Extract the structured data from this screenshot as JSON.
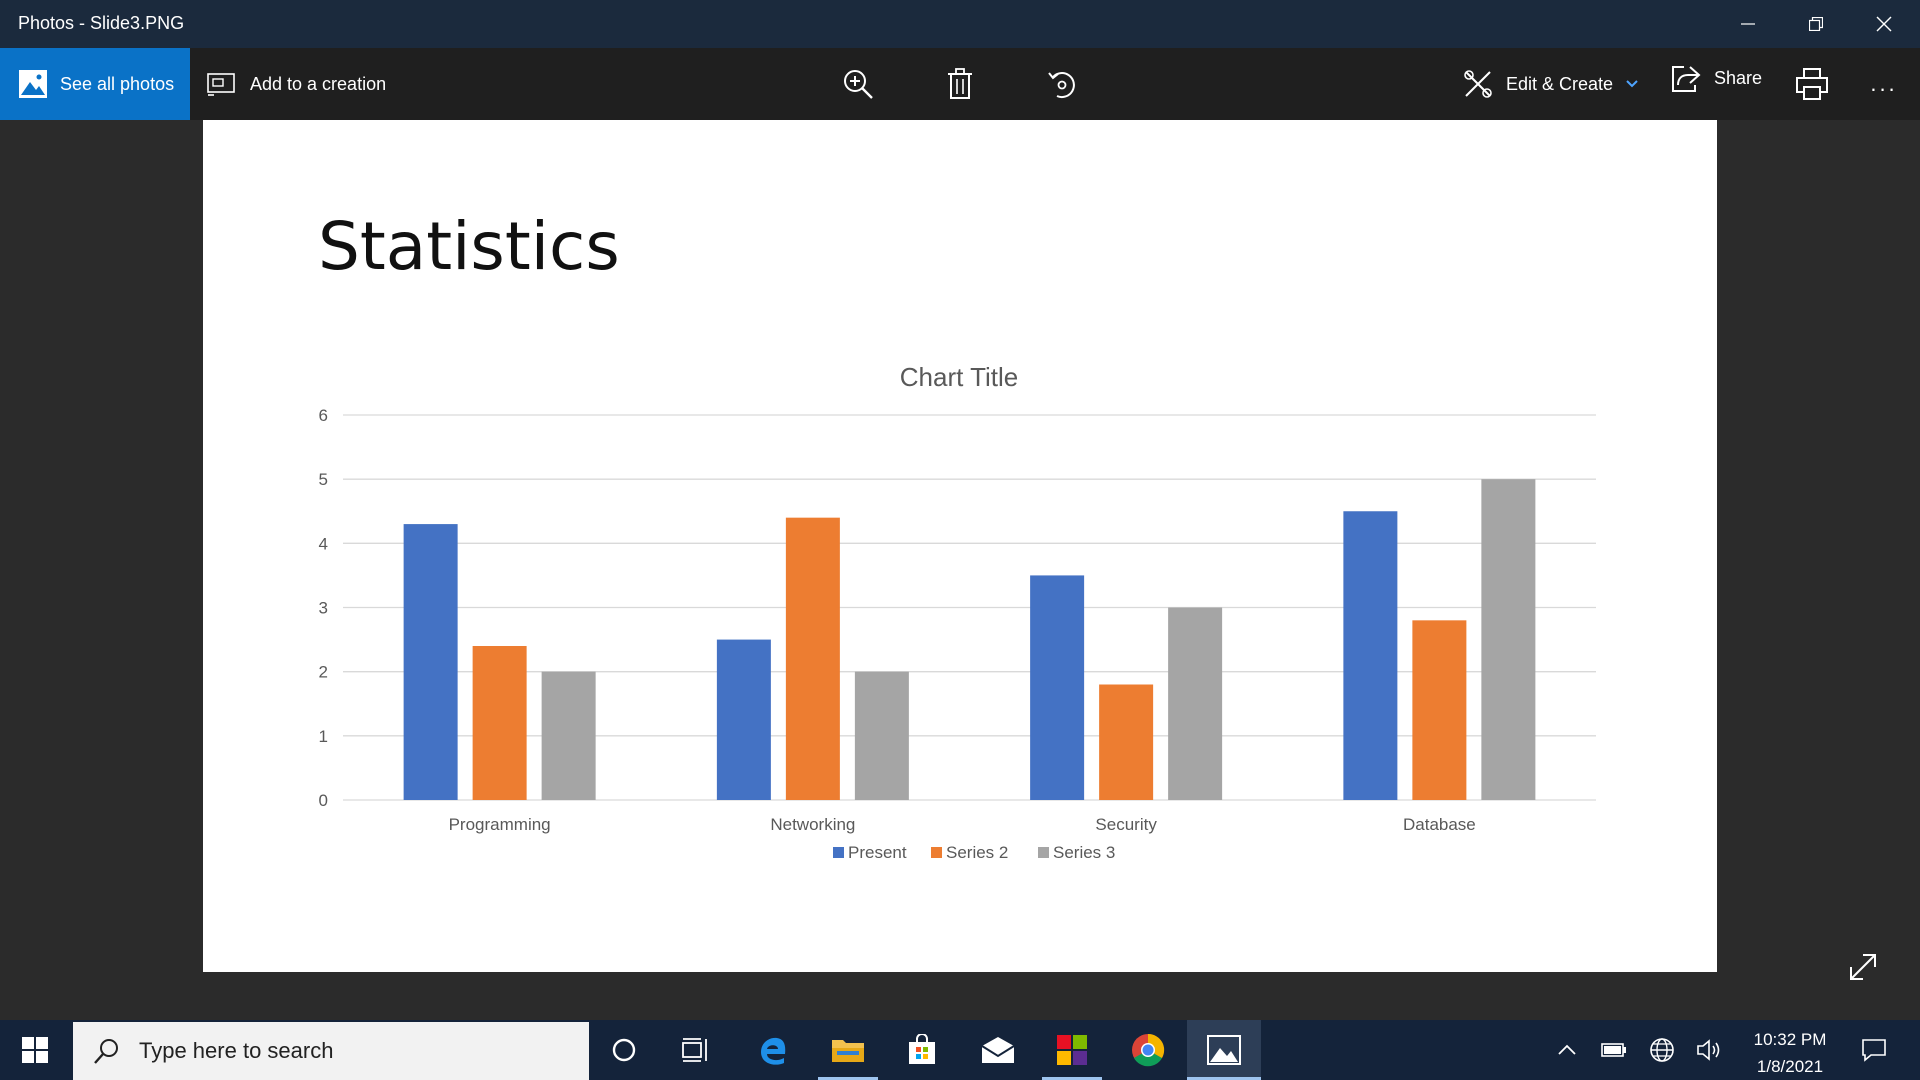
{
  "window": {
    "title": "Photos - Slide3.PNG"
  },
  "toolbar": {
    "see_all_photos": "See all photos",
    "add_to_creation": "Add to a creation",
    "edit_create": "Edit & Create",
    "share": "Share",
    "more": "..."
  },
  "slide": {
    "title": "Statistics"
  },
  "chart_data": {
    "type": "bar",
    "title": "Chart Title",
    "categories": [
      "Programming",
      "Networking",
      "Security",
      "Database"
    ],
    "series": [
      {
        "name": "Present",
        "color": "#4472c4",
        "values": [
          4.3,
          2.5,
          3.5,
          4.5
        ]
      },
      {
        "name": "Series 2",
        "color": "#ed7d31",
        "values": [
          2.4,
          4.4,
          1.8,
          2.8
        ]
      },
      {
        "name": "Series 3",
        "color": "#a5a5a5",
        "values": [
          2,
          2,
          3,
          5
        ]
      }
    ],
    "ylim": [
      0,
      6
    ],
    "yticks": [
      "0",
      "1",
      "2",
      "3",
      "4",
      "5",
      "6"
    ],
    "grid": true,
    "legend": "bottom"
  },
  "taskbar": {
    "search_placeholder": "Type here to search",
    "time": "10:32 PM",
    "date": "1/8/2021"
  }
}
